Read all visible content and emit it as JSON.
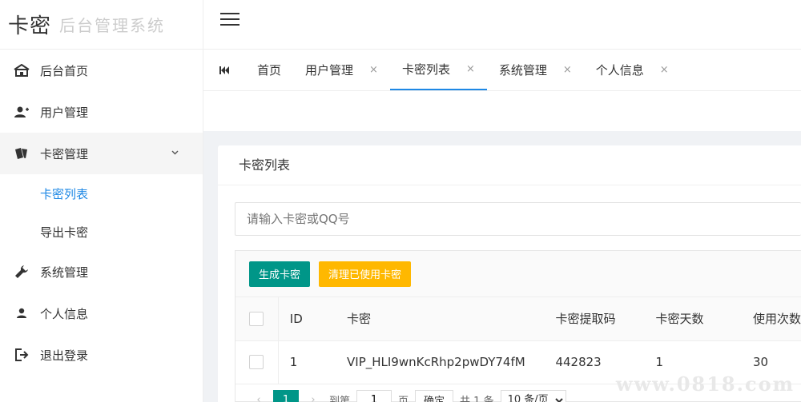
{
  "logo": {
    "brand": "卡密",
    "subtitle": "后台管理系统"
  },
  "sidebar": {
    "items": [
      {
        "label": "后台首页",
        "icon": "home-icon"
      },
      {
        "label": "用户管理",
        "icon": "users-icon"
      },
      {
        "label": "卡密管理",
        "icon": "cards-icon",
        "expanded": true,
        "children": [
          {
            "label": "卡密列表",
            "active": true
          },
          {
            "label": "导出卡密"
          }
        ]
      },
      {
        "label": "系统管理",
        "icon": "wrench-icon"
      },
      {
        "label": "个人信息",
        "icon": "user-icon"
      },
      {
        "label": "退出登录",
        "icon": "logout-icon"
      }
    ]
  },
  "tabs": [
    {
      "label": "首页",
      "closable": false
    },
    {
      "label": "用户管理",
      "closable": true
    },
    {
      "label": "卡密列表",
      "closable": true,
      "active": true
    },
    {
      "label": "系统管理",
      "closable": true
    },
    {
      "label": "个人信息",
      "closable": true
    }
  ],
  "tab_close_glyph": "×",
  "tab_first_glyph": "⏮",
  "card": {
    "title": "卡密列表",
    "search_placeholder": "请输入卡密或QQ号",
    "buttons": {
      "generate": "生成卡密",
      "clear_used": "清理已使用卡密"
    }
  },
  "table": {
    "headers": [
      "ID",
      "卡密",
      "卡密提取码",
      "卡密天数",
      "使用次数"
    ],
    "rows": [
      {
        "id": "1",
        "card": "VIP_HLI9wnKcRhp2pwDY74fM",
        "code": "442823",
        "days": "1",
        "uses": "30"
      }
    ]
  },
  "pager": {
    "prev": "‹",
    "next": "›",
    "current": "1",
    "goto_label": "到第",
    "page_value": "1",
    "page_unit": "页",
    "confirm": "确定",
    "total": "共 1 条",
    "per_page": "10 条/页"
  },
  "watermark": "www.0818.com",
  "colors": {
    "primary": "#009688",
    "warning": "#ffb800",
    "accent": "#1e88e5"
  }
}
